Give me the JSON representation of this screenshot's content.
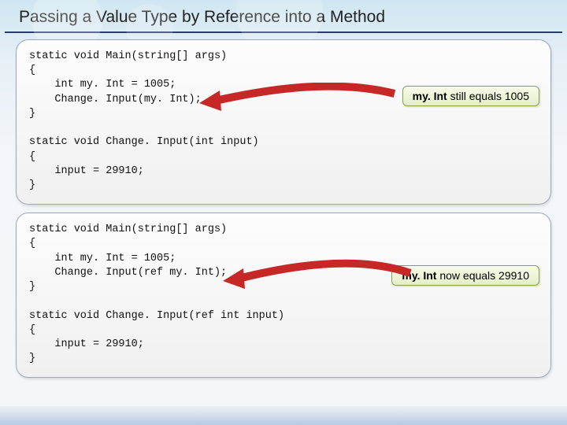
{
  "title": "Passing a Value Type by Reference into a Method",
  "panel1": {
    "code": "static void Main(string[] args)\n{\n    int my. Int = 1005;\n    Change. Input(my. Int);\n}\n\nstatic void Change. Input(int input)\n{\n    input = 29910;\n}",
    "callout_bold": "my. Int",
    "callout_rest": " still equals 1005"
  },
  "panel2": {
    "code": "static void Main(string[] args)\n{\n    int my. Int = 1005;\n    Change. Input(ref my. Int);\n}\n\nstatic void Change. Input(ref int input)\n{\n    input = 29910;\n}",
    "callout_bold": "my. Int",
    "callout_rest": " now equals 29910"
  }
}
